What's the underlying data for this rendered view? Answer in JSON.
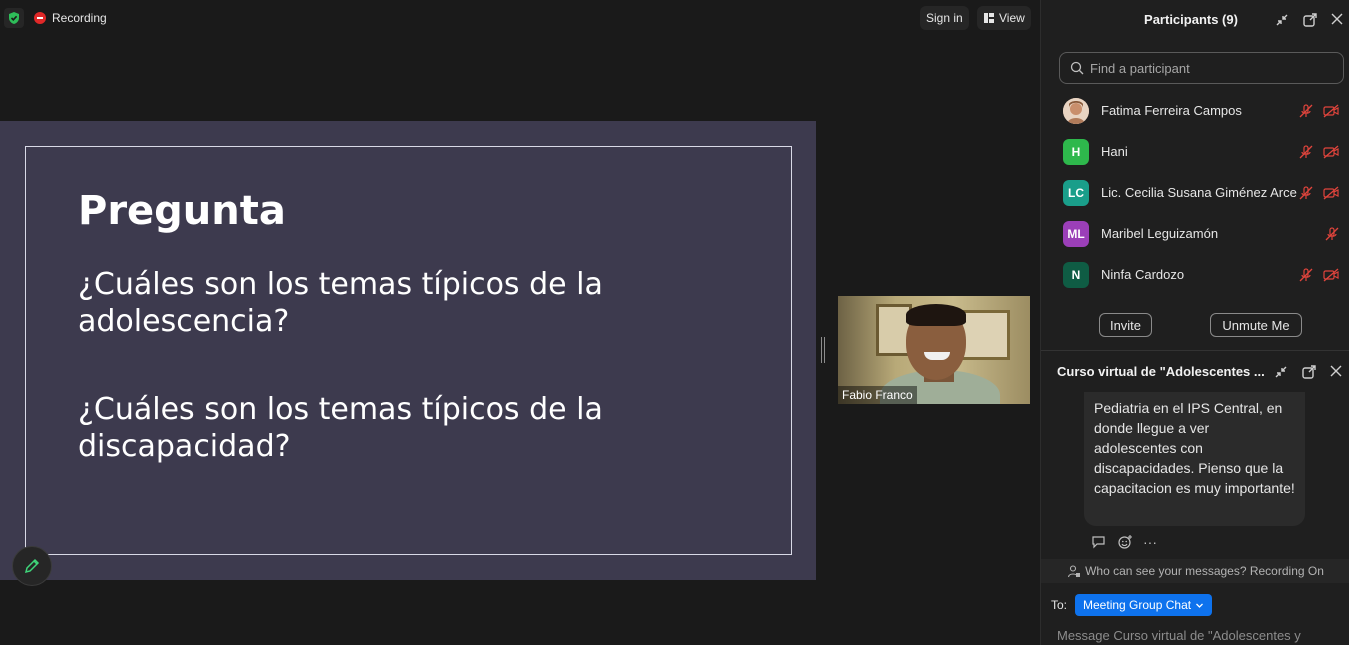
{
  "topbar": {
    "recording_label": "Recording",
    "signin_label": "Sign in",
    "view_label": "View"
  },
  "slide": {
    "title": "Pregunta",
    "question1": "¿Cuáles son los temas típicos de la adolescencia?",
    "question2": "¿Cuáles son los temas típicos de la discapacidad?"
  },
  "video": {
    "name": "Fabio Franco"
  },
  "participants_panel": {
    "title": "Participants (9)",
    "search_placeholder": "Find a participant",
    "participants": [
      {
        "name": "Fatima Ferreira Campos",
        "initials": "",
        "color": "#c9a08a"
      },
      {
        "name": "Hani",
        "initials": "H",
        "color": "#2eb84c"
      },
      {
        "name": "Lic. Cecilia Susana Giménez Arce",
        "initials": "LC",
        "color": "#1a9e8a"
      },
      {
        "name": "Maribel Leguizamón",
        "initials": "ML",
        "color": "#9b3fb8"
      },
      {
        "name": "Ninfa Cardozo",
        "initials": "N",
        "color": "#0f5c44"
      }
    ],
    "invite_label": "Invite",
    "unmute_label": "Unmute Me"
  },
  "chat_panel": {
    "title": "Curso virtual  de \"Adolescentes ...",
    "message": "Pediatria en el IPS Central, en donde llegue a ver adolescentes con discapacidades. Pienso que la capacitacion es muy importante!",
    "privacy_note": "Who can see your messages? Recording On",
    "to_label": "To:",
    "recipient": "Meeting Group Chat",
    "message_placeholder": "Message Curso virtual  de \"Adolescentes y"
  },
  "colors": {
    "accent": "#0e72ed",
    "recording": "#e02828",
    "muted_icon": "#e0443c",
    "slide_bg": "#3d3a4e"
  }
}
